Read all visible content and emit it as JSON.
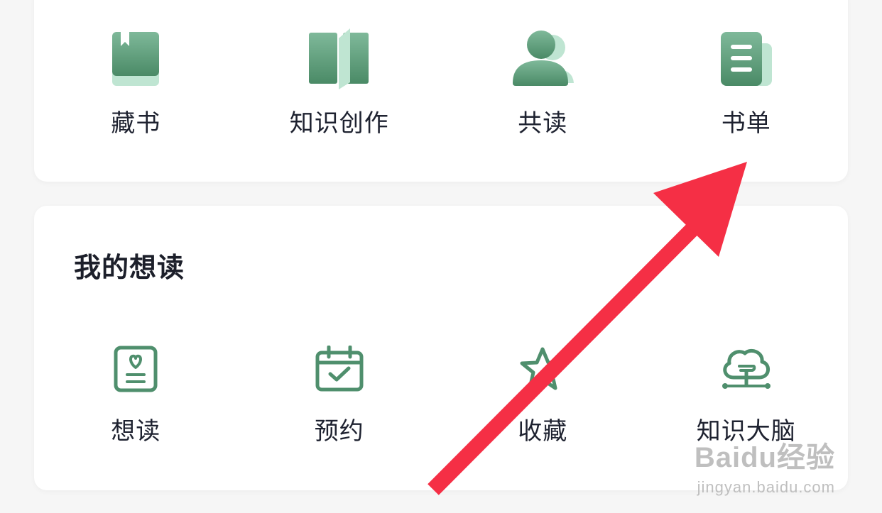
{
  "top_card": {
    "items": [
      {
        "label": "藏书",
        "icon": "book-icon"
      },
      {
        "label": "知识创作",
        "icon": "open-book-icon"
      },
      {
        "label": "共读",
        "icon": "people-icon"
      },
      {
        "label": "书单",
        "icon": "booklist-icon"
      }
    ]
  },
  "wishlist": {
    "title": "我的想读",
    "items": [
      {
        "label": "想读",
        "icon": "heart-card-icon"
      },
      {
        "label": "预约",
        "icon": "calendar-check-icon"
      },
      {
        "label": "收藏",
        "icon": "star-icon"
      },
      {
        "label": "知识大脑",
        "icon": "brain-tree-icon"
      }
    ]
  },
  "watermark": {
    "main": "Baidu经验",
    "sub": "jingyan.baidu.com"
  },
  "colors": {
    "accent": "#4f8f6d",
    "accent_light": "#b9e3cf",
    "arrow": "#f52f45"
  }
}
